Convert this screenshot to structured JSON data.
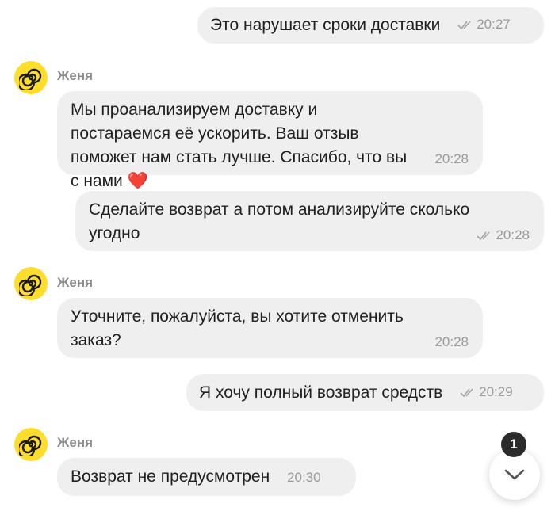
{
  "colors": {
    "bubble_bg": "#efefef",
    "avatar_bg": "#ffdd2d",
    "time_text": "#9a9a9a",
    "badge_bg": "#2b2b2b"
  },
  "messages": [
    {
      "direction": "outgoing",
      "text": "Это нарушает сроки доставки",
      "time": "20:27",
      "status_icon": "double-check-icon"
    },
    {
      "direction": "incoming",
      "sender": "Женя",
      "text": "Мы проанализируем доставку и постараемся её ускорить. Ваш отзыв поможет нам стать лучше. Спасибо, что вы с нами",
      "emoji": "❤️",
      "time": "20:28"
    },
    {
      "direction": "outgoing",
      "text": "Сделайте возврат а потом анализируйте сколько угодно",
      "time": "20:28",
      "status_icon": "double-check-icon"
    },
    {
      "direction": "incoming",
      "sender": "Женя",
      "text": "Уточните, пожалуйста, вы хотите отменить заказ?",
      "time": "20:28"
    },
    {
      "direction": "outgoing",
      "text": "Я хочу полный возврат средств",
      "time": "20:29",
      "status_icon": "double-check-icon"
    },
    {
      "direction": "incoming",
      "sender": "Женя",
      "text": "Возврат не предусмотрен",
      "time": "20:30"
    }
  ],
  "scroll_down": {
    "icon": "chevron-down-icon",
    "unread_count": "1"
  }
}
